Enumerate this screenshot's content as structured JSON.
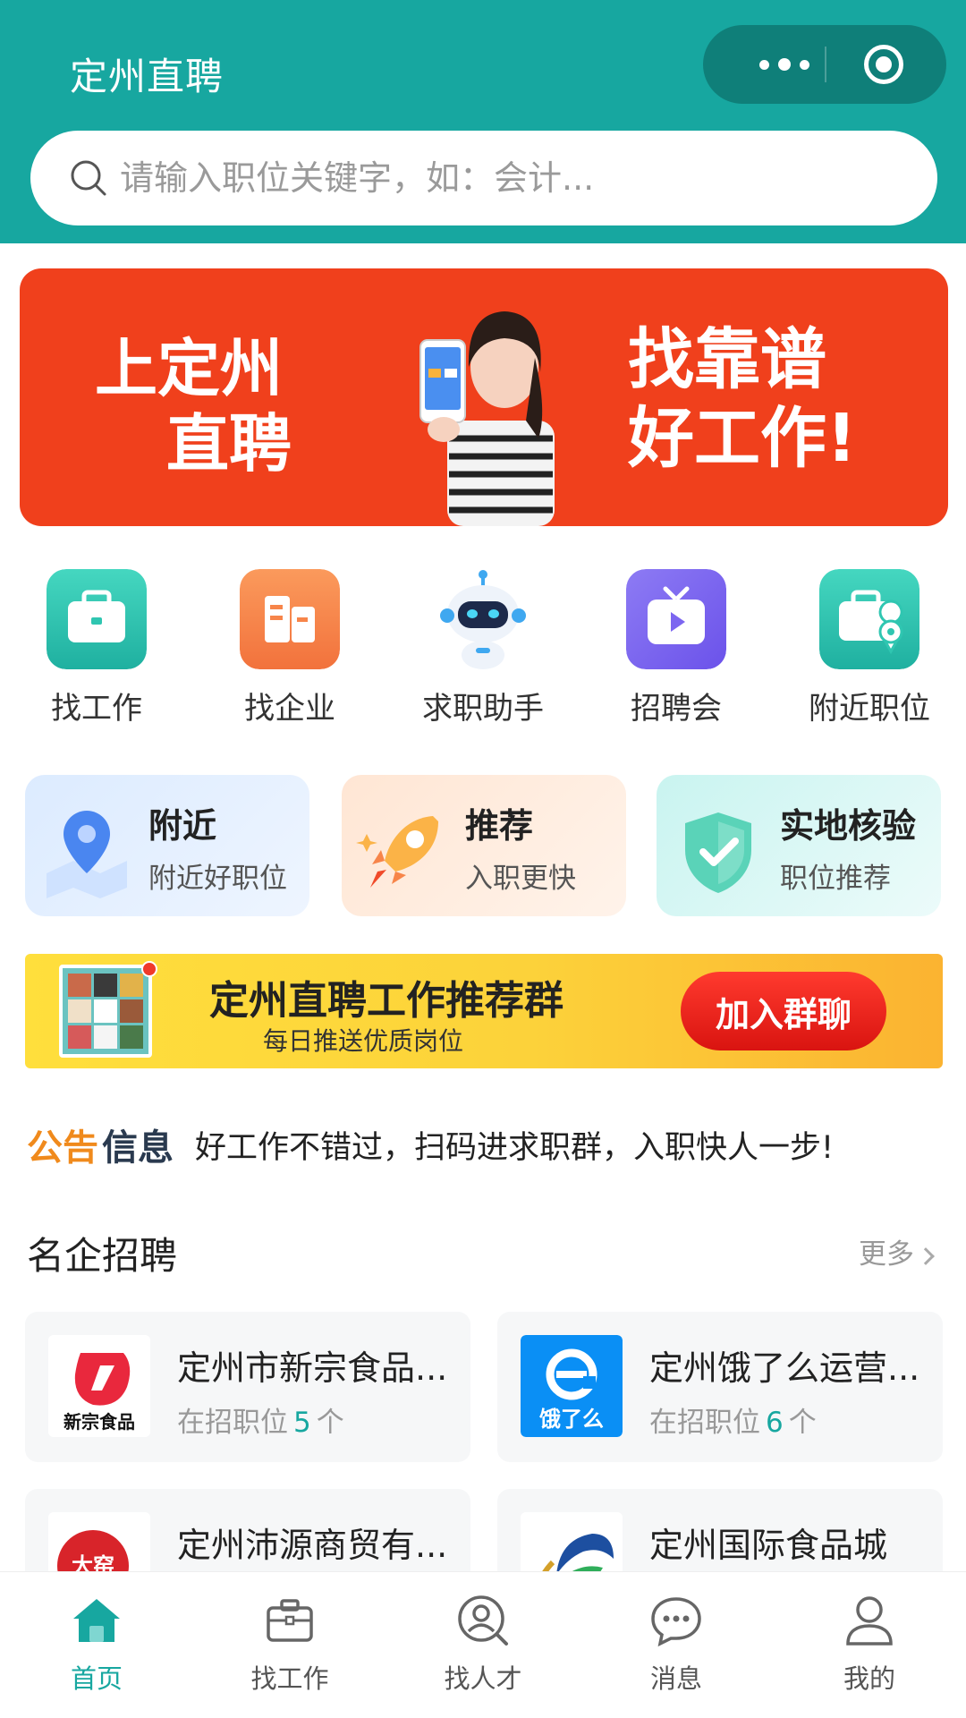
{
  "header": {
    "title": "定州直聘",
    "capsule": {
      "more_icon": "more-dots-icon",
      "close_icon": "target-icon"
    },
    "search": {
      "placeholder": "请输入职位关键字，如：会计..."
    }
  },
  "banner": {
    "left_line1": "上定州",
    "left_line2": "直聘",
    "right_line1": "找靠谱",
    "right_line2": "好工作!"
  },
  "quick_menu": [
    {
      "label": "找工作",
      "icon": "briefcase-icon",
      "color": "#2fc6b1"
    },
    {
      "label": "找企业",
      "icon": "building-icon",
      "color": "#f7854a"
    },
    {
      "label": "求职助手",
      "icon": "robot-icon",
      "color": "#3fa8f0"
    },
    {
      "label": "招聘会",
      "icon": "tv-play-icon",
      "color": "#7c66f0"
    },
    {
      "label": "附近职位",
      "icon": "briefcase-location-icon",
      "color": "#2fc6b1"
    }
  ],
  "features": [
    {
      "title": "附近",
      "subtitle": "附近好职位",
      "icon": "map-pin-icon"
    },
    {
      "title": "推荐",
      "subtitle": "入职更快",
      "icon": "rocket-icon"
    },
    {
      "title": "实地核验",
      "subtitle": "职位推荐",
      "icon": "shield-check-icon"
    }
  ],
  "group": {
    "title": "定州直聘工作推荐群",
    "subtitle": "每日推送优质岗位",
    "join_label": "加入群聊"
  },
  "notice": {
    "tag_part1": "公告",
    "tag_part2": "信息",
    "text": "好工作不错过，扫码进求职群，入职快人一步!"
  },
  "companies_section": {
    "title": "名企招聘",
    "more_label": "更多",
    "jobs_prefix": "在招职位",
    "jobs_suffix": "个",
    "items": [
      {
        "name": "定州市新宗食品...",
        "jobs": "5",
        "logo_text": "新宗食品"
      },
      {
        "name": "定州饿了么运营...",
        "jobs": "6",
        "logo_text": "饿了么"
      },
      {
        "name": "定州沛源商贸有...",
        "jobs": "",
        "logo_text": "大窑"
      },
      {
        "name": "定州国际食品城",
        "jobs": "",
        "logo_text": ""
      }
    ]
  },
  "tabbar": [
    {
      "label": "首页",
      "icon": "home-icon",
      "active": true
    },
    {
      "label": "找工作",
      "icon": "briefcase-icon",
      "active": false
    },
    {
      "label": "找人才",
      "icon": "talent-search-icon",
      "active": false
    },
    {
      "label": "消息",
      "icon": "message-icon",
      "active": false
    },
    {
      "label": "我的",
      "icon": "user-icon",
      "active": false
    }
  ],
  "colors": {
    "primary": "#17a7a0",
    "banner": "#f0401c",
    "accent": "#f03a2a"
  }
}
